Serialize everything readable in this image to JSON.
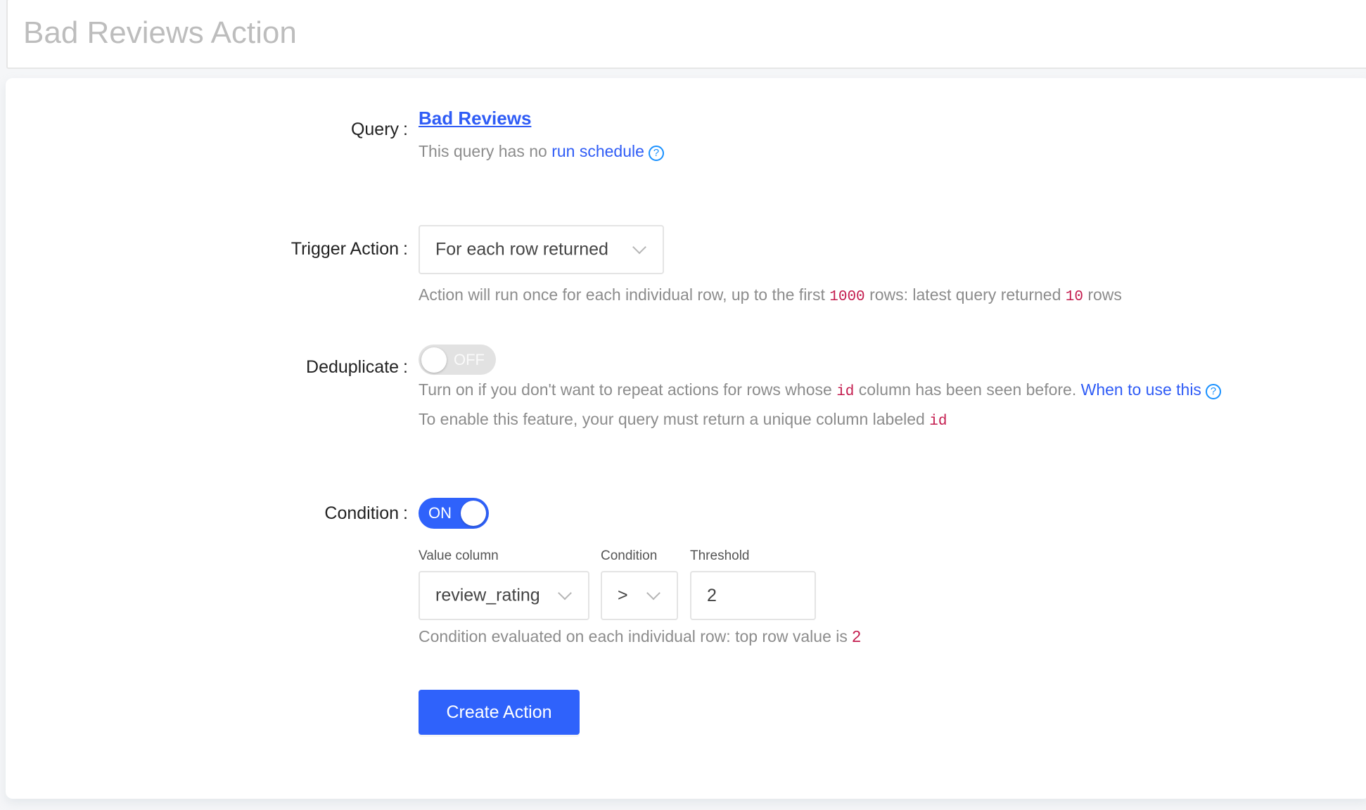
{
  "page": {
    "title": "Bad Reviews Action"
  },
  "query": {
    "label": "Query",
    "colon": ":",
    "name": "Bad Reviews",
    "schedule_prefix": "This query has no",
    "schedule_link": "run schedule",
    "help_glyph": "?"
  },
  "trigger": {
    "label": "Trigger Action",
    "colon": ":",
    "selected": "For each row returned",
    "help": {
      "part1": "Action will run once for each individual row, up to the first",
      "limit": "1000",
      "part2": "rows: latest query returned",
      "returned": "10",
      "part3": "rows"
    }
  },
  "deduplicate": {
    "label": "Deduplicate",
    "colon": ":",
    "toggle_state": "OFF",
    "enabled": false,
    "line1": {
      "part1": "Turn on if you don't want to repeat actions for rows whose",
      "column": "id",
      "part2": "column has been seen before.",
      "link": "When to use this",
      "help_glyph": "?"
    },
    "line2": {
      "part1": "To enable this feature, your query must return a unique column labeled",
      "column": "id"
    }
  },
  "condition": {
    "label": "Condition",
    "colon": ":",
    "toggle_state": "ON",
    "enabled": true,
    "fields": {
      "value_column_label": "Value column",
      "value_column": "review_rating",
      "operator_label": "Condition",
      "operator": ">",
      "threshold_label": "Threshold",
      "threshold": "2"
    },
    "help": {
      "part1": "Condition evaluated on each individual row: top row value is",
      "value": "2"
    }
  },
  "actions": {
    "create_label": "Create Action"
  },
  "colors": {
    "accent": "#2f62fb",
    "link": "#2f5cf6",
    "code": "#c41d4f",
    "muted": "#8c8c8c",
    "title": "#bdbdbd"
  }
}
